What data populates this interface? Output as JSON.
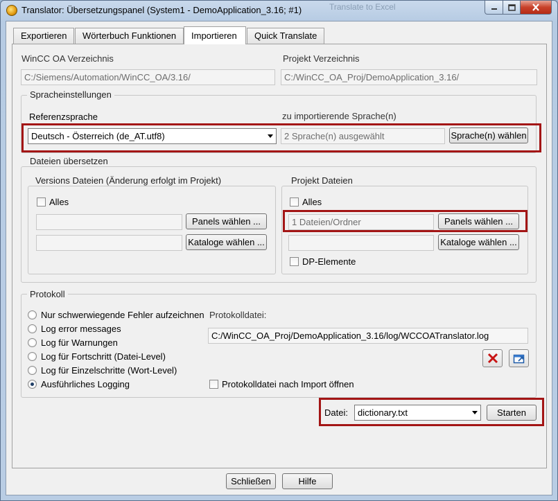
{
  "window": {
    "title": "Translator: Übersetzungspanel (System1 - DemoApplication_3.16; #1)",
    "ghost_title": "Translate to Excel",
    "accent": "#a31515"
  },
  "tabs": [
    {
      "label": "Exportieren"
    },
    {
      "label": "Wörterbuch Funktionen"
    },
    {
      "label": "Importieren"
    },
    {
      "label": "Quick Translate"
    }
  ],
  "paths": {
    "winccoa_label": "WinCC OA Verzeichnis",
    "winccoa_value": "C:/Siemens/Automation/WinCC_OA/3.16/",
    "project_label": "Projekt Verzeichnis",
    "project_value": "C:/WinCC_OA_Proj/DemoApplication_3.16/"
  },
  "language": {
    "legend": "Spracheinstellungen",
    "reference_label": "Referenzsprache",
    "reference_value": "Deutsch - Österreich (de_AT.utf8)",
    "import_label": "zu importierende Sprache(n)",
    "import_value": "2 Sprache(n) ausgewählt",
    "choose_button": "Sprache(n) wählen"
  },
  "files": {
    "legend": "Dateien übersetzen",
    "version": {
      "legend": "Versions Dateien (Änderung erfolgt im Projekt)",
      "all_label": "Alles",
      "panels_value": "",
      "panels_button": "Panels wählen ...",
      "catalogs_value": "",
      "catalogs_button": "Kataloge wählen ..."
    },
    "project": {
      "legend": "Projekt Dateien",
      "all_label": "Alles",
      "panels_value": "1 Dateien/Ordner",
      "panels_button": "Panels wählen ...",
      "catalogs_value": "",
      "catalogs_button": "Kataloge wählen ...",
      "dp_label": "DP-Elemente"
    }
  },
  "log": {
    "legend": "Protokoll",
    "options": [
      {
        "label": "Nur schwerwiegende Fehler aufzeichnen",
        "selected": false
      },
      {
        "label": "Log error messages",
        "selected": false
      },
      {
        "label": "Log für Warnungen",
        "selected": false
      },
      {
        "label": "Log für Fortschritt (Datei-Level)",
        "selected": false
      },
      {
        "label": "Log für Einzelschritte (Wort-Level)",
        "selected": false
      },
      {
        "label": "Ausführliches Logging",
        "selected": true
      }
    ],
    "file_label": "Protokolldatei:",
    "file_value": "C:/WinCC_OA_Proj/DemoApplication_3.16/log/WCCOATranslator.log",
    "open_after_label": "Protokolldatei nach Import öffnen"
  },
  "import": {
    "file_label": "Datei:",
    "file_value": "dictionary.txt",
    "start_button": "Starten"
  },
  "footer": {
    "close_button": "Schließen",
    "help_button": "Hilfe"
  }
}
